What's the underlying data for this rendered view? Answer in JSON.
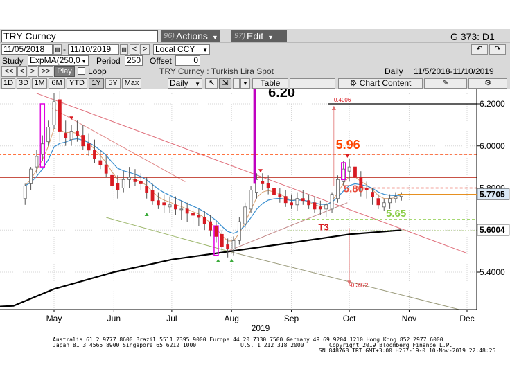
{
  "toolbar": {
    "security": "TRY  Curncy",
    "actions_num": "96)",
    "actions_label": "Actions",
    "edit_num": "97)",
    "edit_label": "Edit",
    "page_id": "G 373: D1"
  },
  "range": {
    "start_date": "11/05/2018",
    "end_date": "11/10/2019",
    "currency": "Local CCY"
  },
  "study": {
    "label": "Study",
    "value": "ExpMA(250,0",
    "period_label": "Period",
    "period_value": "250",
    "offset_label": "Offset",
    "offset_value": "0"
  },
  "playback": {
    "play_label": "Play",
    "loop_label": "Loop",
    "title": "TRY  Curncy : Turkish Lira Spot",
    "freq": "Daily",
    "span": "11/5/2018-11/10/2019"
  },
  "periods": {
    "items": [
      "1D",
      "3D",
      "1M",
      "6M",
      "YTD",
      "1Y",
      "5Y",
      "Max"
    ],
    "selected": "1Y",
    "interval": "Daily",
    "table_label": "Table",
    "content_label": "Chart Content"
  },
  "chart_data": {
    "type": "candlestick",
    "title": "TRY  Curncy : Turkish Lira Spot",
    "frequency": "Daily",
    "date_range": [
      "2018-11-05",
      "2019-11-10"
    ],
    "xlabel": "2019",
    "x_tick_labels": [
      "May",
      "Jun",
      "Jul",
      "Aug",
      "Sep",
      "Oct",
      "Nov",
      "Dec"
    ],
    "x_ticks": [
      "2019-05-01",
      "2019-06-01",
      "2019-07-01",
      "2019-08-01",
      "2019-09-01",
      "2019-10-01",
      "2019-11-01",
      "2019-12-01"
    ],
    "y_tick_labels": [
      "5.4000",
      "5.6000",
      "5.8000",
      "6.0000",
      "6.2000"
    ],
    "y_ticks": [
      5.4,
      5.6,
      5.8,
      6.0,
      6.2
    ],
    "ylim": [
      5.2,
      6.3
    ],
    "last_price": "5.7705",
    "ema_value": "5.6004",
    "grid": true,
    "series": [
      {
        "name": "",
        "kind": "ohlc",
        "color": "#d81b22",
        "x": [
          "2019-04-16",
          "2019-04-19",
          "2019-04-22",
          "2019-04-25",
          "2019-04-28",
          "2019-05-01",
          "2019-05-04",
          "2019-05-07",
          "2019-05-10",
          "2019-05-13",
          "2019-05-16",
          "2019-05-19",
          "2019-05-22",
          "2019-05-25",
          "2019-05-28",
          "2019-05-31",
          "2019-06-03",
          "2019-06-06",
          "2019-06-09",
          "2019-06-12",
          "2019-06-15",
          "2019-06-18",
          "2019-06-21",
          "2019-06-24",
          "2019-06-27",
          "2019-06-30",
          "2019-07-03",
          "2019-07-06",
          "2019-07-09",
          "2019-07-12",
          "2019-07-15",
          "2019-07-18",
          "2019-07-21",
          "2019-07-24",
          "2019-07-27",
          "2019-07-30",
          "2019-08-02",
          "2019-08-05",
          "2019-08-08",
          "2019-08-11",
          "2019-08-14",
          "2019-08-17",
          "2019-08-20",
          "2019-08-23",
          "2019-08-26",
          "2019-08-29",
          "2019-09-01",
          "2019-09-04",
          "2019-09-07",
          "2019-09-10",
          "2019-09-13",
          "2019-09-16",
          "2019-09-19",
          "2019-09-22",
          "2019-09-25",
          "2019-09-28",
          "2019-10-01",
          "2019-10-04",
          "2019-10-07",
          "2019-10-10",
          "2019-10-13",
          "2019-10-16",
          "2019-10-19",
          "2019-10-22",
          "2019-10-25",
          "2019-10-28"
        ],
        "open": [
          5.75,
          5.82,
          5.9,
          5.96,
          6.02,
          6.1,
          6.22,
          6.06,
          6.03,
          6.07,
          6.05,
          6.01,
          5.98,
          5.93,
          5.91,
          5.86,
          5.82,
          5.8,
          5.84,
          5.84,
          5.83,
          5.81,
          5.79,
          5.74,
          5.73,
          5.71,
          5.72,
          5.7,
          5.7,
          5.68,
          5.67,
          5.66,
          5.64,
          5.62,
          5.58,
          5.53,
          5.51,
          5.55,
          5.63,
          5.7,
          5.78,
          5.83,
          5.82,
          5.8,
          5.77,
          5.76,
          5.73,
          5.72,
          5.75,
          5.74,
          5.73,
          5.71,
          5.7,
          5.7,
          5.75,
          5.83,
          5.88,
          5.9,
          5.85,
          5.8,
          5.78,
          5.75,
          5.71,
          5.73,
          5.75,
          5.76
        ],
        "high": [
          5.82,
          5.9,
          5.98,
          6.05,
          6.12,
          6.25,
          6.26,
          6.12,
          6.1,
          6.12,
          6.1,
          6.06,
          6.03,
          5.98,
          5.95,
          5.9,
          5.86,
          5.88,
          5.9,
          5.89,
          5.87,
          5.85,
          5.82,
          5.78,
          5.77,
          5.76,
          5.76,
          5.74,
          5.73,
          5.71,
          5.7,
          5.69,
          5.67,
          5.64,
          5.6,
          5.56,
          5.57,
          5.66,
          5.73,
          5.81,
          5.87,
          5.87,
          5.86,
          5.82,
          5.8,
          5.79,
          5.77,
          5.78,
          5.79,
          5.77,
          5.76,
          5.74,
          5.73,
          5.78,
          5.86,
          5.93,
          5.94,
          5.92,
          5.88,
          5.83,
          5.8,
          5.77,
          5.75,
          5.77,
          5.78,
          5.78
        ],
        "low": [
          5.72,
          5.79,
          5.87,
          5.93,
          6.0,
          6.08,
          6.02,
          6.0,
          6.0,
          6.02,
          5.98,
          5.95,
          5.92,
          5.89,
          5.85,
          5.79,
          5.75,
          5.78,
          5.8,
          5.81,
          5.79,
          5.75,
          5.72,
          5.7,
          5.68,
          5.68,
          5.67,
          5.65,
          5.64,
          5.63,
          5.62,
          5.6,
          5.57,
          5.54,
          5.5,
          5.47,
          5.48,
          5.53,
          5.61,
          5.68,
          5.75,
          5.79,
          5.77,
          5.75,
          5.73,
          5.71,
          5.7,
          5.69,
          5.72,
          5.7,
          5.68,
          5.67,
          5.66,
          5.68,
          5.73,
          5.81,
          5.83,
          5.82,
          5.76,
          5.75,
          5.72,
          5.7,
          5.69,
          5.7,
          5.73,
          5.74
        ],
        "close": [
          5.81,
          5.89,
          5.95,
          6.01,
          6.09,
          6.21,
          6.07,
          6.04,
          6.07,
          6.05,
          6.0,
          5.98,
          5.94,
          5.91,
          5.87,
          5.81,
          5.79,
          5.84,
          5.85,
          5.83,
          5.82,
          5.78,
          5.74,
          5.72,
          5.72,
          5.72,
          5.7,
          5.7,
          5.68,
          5.67,
          5.66,
          5.63,
          5.6,
          5.57,
          5.52,
          5.51,
          5.55,
          5.64,
          5.71,
          5.79,
          5.84,
          5.82,
          5.8,
          5.77,
          5.76,
          5.73,
          5.72,
          5.75,
          5.74,
          5.72,
          5.7,
          5.7,
          5.72,
          5.77,
          5.84,
          5.89,
          5.9,
          5.85,
          5.8,
          5.79,
          5.76,
          5.72,
          5.73,
          5.75,
          5.76,
          5.77
        ]
      },
      {
        "name": "",
        "kind": "line",
        "color": "#000000",
        "x": [
          "2019-04-10",
          "2019-05-01",
          "2019-06-01",
          "2019-07-01",
          "2019-08-01",
          "2019-09-01",
          "2019-10-01",
          "2019-10-28"
        ],
        "y": [
          5.24,
          5.32,
          5.4,
          5.46,
          5.5,
          5.54,
          5.58,
          5.6
        ]
      }
    ],
    "levels": [
      {
        "y": 6.2,
        "label": "6.20",
        "color": "#000000",
        "style": "solid"
      },
      {
        "y": 5.96,
        "label": "5.96",
        "color": "#ff4500",
        "style": "dashed"
      },
      {
        "y": 5.85,
        "label": "",
        "color": "#c0392b",
        "style": "solid"
      },
      {
        "y": 5.8,
        "label": "5.80",
        "color": "#e74c3c",
        "style": "dashed"
      },
      {
        "y": 5.65,
        "label": "5.65",
        "color": "#88cc44",
        "style": "dashed"
      }
    ],
    "annotations": [
      {
        "text": "T3",
        "x": "2019-09-15",
        "y": 5.6,
        "color": "#d81b22"
      },
      {
        "text": "0.4006",
        "x": "2019-09-23",
        "y": 6.21,
        "color": "#d81b22"
      },
      {
        "text": "-0.3972",
        "x": "2019-10-01",
        "y": 5.33,
        "color": "#d81b22"
      }
    ]
  },
  "footer": {
    "line1": "Australia 61 2 9777 8600 Brazil 5511 2395 9000 Europe 44 20 7330 7500 Germany 49 69 9204 1210 Hong Kong 852 2977 6000",
    "line2a": "Japan 81 3 4565 8900       Singapore 65 6212 1000",
    "line2b": "U.S. 1 212 318 2000",
    "line2c": "Copyright 2019 Bloomberg Finance L.P.",
    "line3": "SN 848768 TRT  GMT+3:00 H257-19-0 10-Nov-2019 22:48:25"
  }
}
